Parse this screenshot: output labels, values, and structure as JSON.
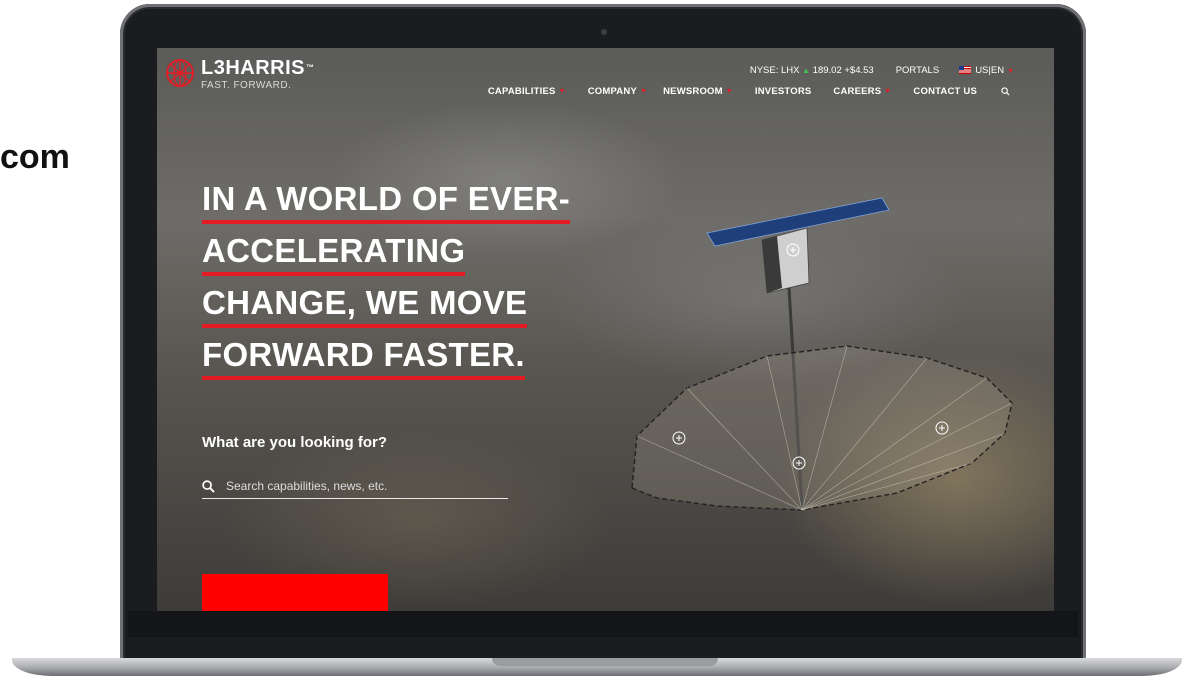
{
  "page": {
    "side_text": "com"
  },
  "brand": {
    "name": "L3HARRIS",
    "tm": "™",
    "tagline": "FAST. FORWARD."
  },
  "topbar": {
    "stock_label": "NYSE: LHX",
    "stock_price": "189.02",
    "stock_change": "+$4.53",
    "portals": "PORTALS",
    "locale": "US|EN"
  },
  "nav": {
    "items": [
      {
        "label": "CAPABILITIES",
        "has_dropdown": true
      },
      {
        "label": "COMPANY",
        "has_dropdown": true
      },
      {
        "label": "NEWSROOM",
        "has_dropdown": true
      },
      {
        "label": "INVESTORS",
        "has_dropdown": false
      },
      {
        "label": "CAREERS",
        "has_dropdown": true
      },
      {
        "label": "CONTACT US",
        "has_dropdown": false
      }
    ]
  },
  "hero": {
    "lines": [
      "IN A WORLD OF EVER-",
      "ACCELERATING",
      "CHANGE, WE MOVE",
      "FORWARD FASTER."
    ]
  },
  "search": {
    "label": "What are you looking for?",
    "placeholder": "Search capabilities, news, etc.",
    "value": ""
  },
  "colors": {
    "accent": "#e31c23",
    "cta": "#ff0000",
    "stock_up": "#3fc24f"
  },
  "icons": {
    "logo": "l3harris-globe-icon",
    "search": "magnifier-icon",
    "flag": "us-flag-icon",
    "hotspot": "plus-circle-icon"
  }
}
